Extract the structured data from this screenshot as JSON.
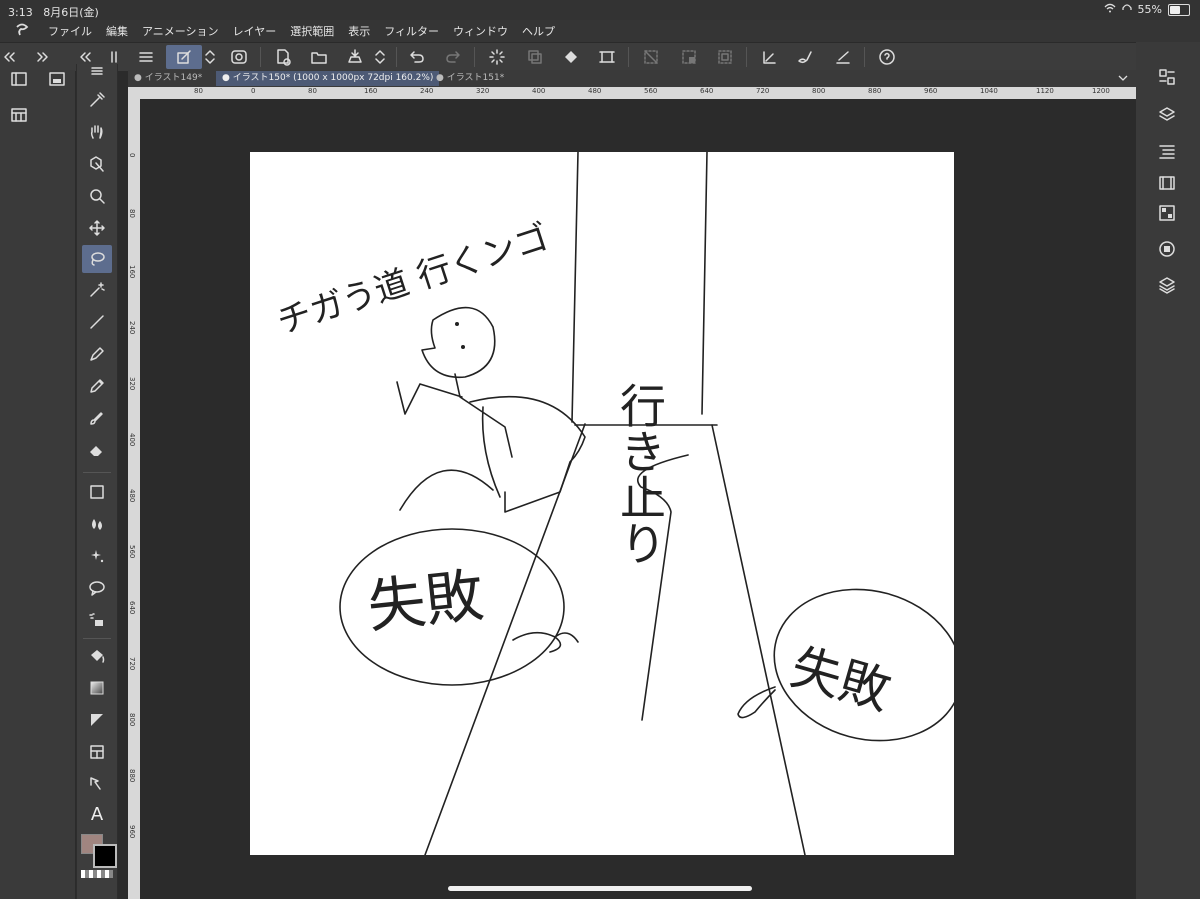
{
  "status_bar": {
    "time": "3:13",
    "date": "8月6日(金)",
    "battery": "55%",
    "battery_level": 0.55
  },
  "menu": [
    "ファイル",
    "編集",
    "アニメーション",
    "レイヤー",
    "選択範囲",
    "表示",
    "フィルター",
    "ウィンドウ",
    "ヘルプ"
  ],
  "tabs": [
    {
      "label": "● イラスト149*"
    },
    {
      "label": "● イラスト150* (1000 x 1000px 72dpi 160.2%)"
    },
    {
      "label": "● イラスト151*"
    }
  ],
  "ruler_h": [
    "80",
    "0",
    "80",
    "160",
    "240",
    "320",
    "400",
    "480",
    "560",
    "640",
    "720",
    "800",
    "880",
    "960",
    "1040",
    "1120",
    "1200"
  ],
  "ruler_v": [
    "0",
    "80",
    "160",
    "240",
    "320",
    "400",
    "480",
    "560",
    "640",
    "720",
    "800",
    "880",
    "960"
  ],
  "toolbox": {
    "text_tool_label": "A"
  },
  "colors": {
    "main": "#a08580",
    "sub": "#000000",
    "accent": "#5d6d8e"
  },
  "drawing_text": {
    "speech": "チガう道 行くンゴ",
    "sign": "行き止り",
    "bubble_left": "失敗",
    "bubble_right": "失敗"
  }
}
